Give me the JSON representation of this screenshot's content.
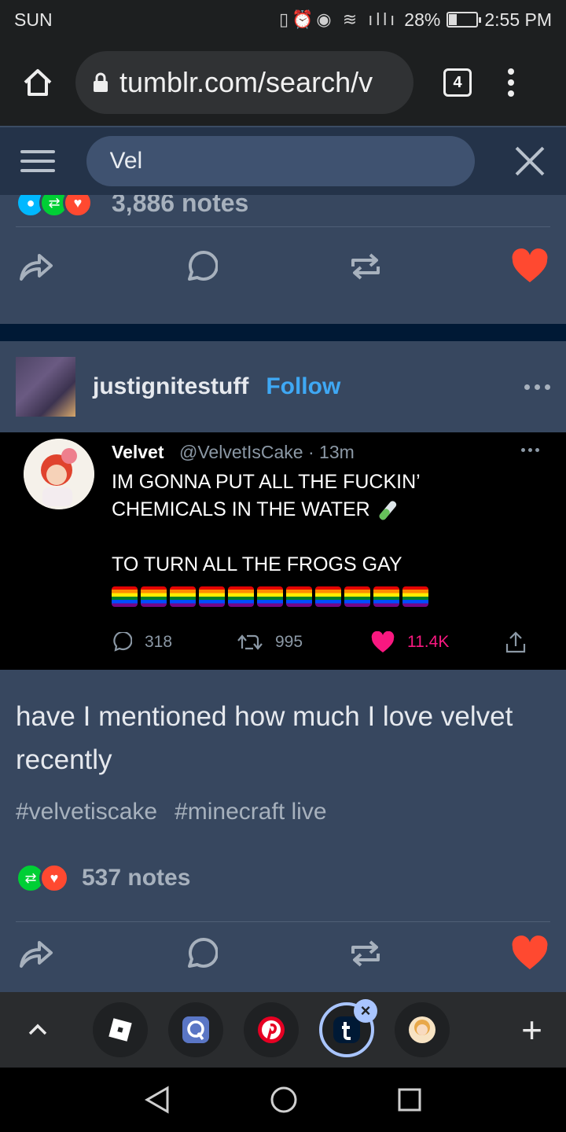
{
  "status_bar": {
    "day": "SUN",
    "battery_percent": "28%",
    "battery_level": 0.28,
    "time": "2:55 PM"
  },
  "browser": {
    "url": "tumblr.com/search/v",
    "tab_count": "4"
  },
  "search": {
    "query": "Vel"
  },
  "previous_post": {
    "notes": "3,886 notes"
  },
  "post": {
    "blog_name": "justignitestuff",
    "follow_label": "Follow",
    "tweet": {
      "name": "Velvet",
      "handle_time": "@VelvetIsCake · 13m",
      "line1": "IM GONNA PUT ALL THE FUCKIN’",
      "line2": "CHEMICALS IN THE WATER",
      "line3": "TO TURN ALL THE FROGS GAY",
      "flag_count": 11,
      "replies": "318",
      "retweets": "995",
      "likes": "11.4K"
    },
    "caption": "have I mentioned how much I love velvet recently",
    "tags": [
      "#velvetiscake",
      "#minecraft live"
    ],
    "notes": "537 notes"
  },
  "colors": {
    "tumblr_blue": "#001935",
    "card": "#37475f",
    "follow": "#3fa8f4",
    "like_red": "#ff4930",
    "reblog_green": "#00cf35",
    "twitter_pink": "#f91880"
  },
  "tab_strip": {
    "tabs": [
      "roblox-tab",
      "quora-tab",
      "pinterest-tab",
      "tumblr-tab",
      "avatar-tab"
    ]
  }
}
